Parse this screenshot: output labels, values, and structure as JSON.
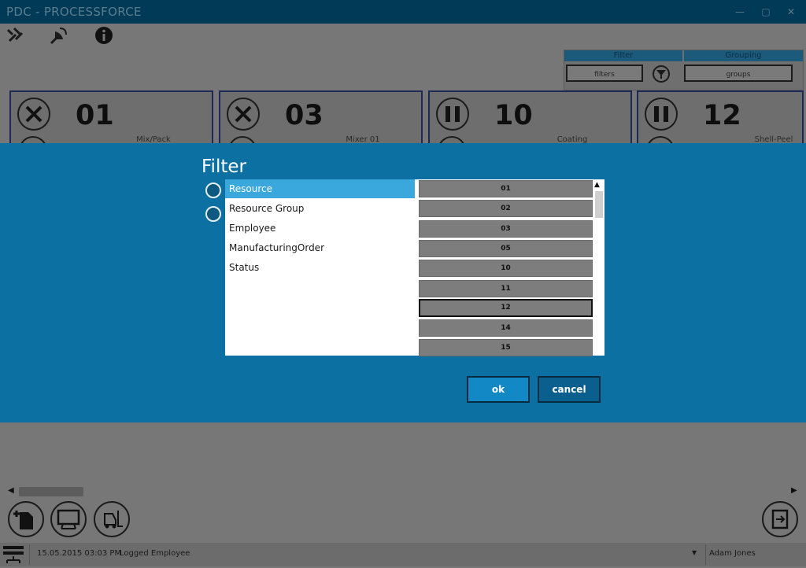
{
  "window": {
    "title": "PDC - PROCESSFORCE",
    "minimize": "—",
    "maximize": "▢",
    "close": "✕"
  },
  "toolbar": {
    "icons": [
      "tools-icon",
      "satellite-icon",
      "info-icon"
    ]
  },
  "filter_panel": {
    "filter_header": "Filter",
    "grouping_header": "Grouping",
    "filters_button": "filters",
    "groups_button": "groups"
  },
  "cards": [
    {
      "number": "01",
      "name": "Mix/Pack",
      "status_icon": "tools-icon"
    },
    {
      "number": "03",
      "name": "Mixer 01",
      "status_icon": "tools-icon"
    },
    {
      "number": "10",
      "name": "Coating",
      "status_icon": "pause-icon"
    },
    {
      "number": "12",
      "name": "Shell-Peel",
      "status_icon": "pause-icon"
    }
  ],
  "dialog": {
    "title": "Filter",
    "categories": [
      {
        "label": "Resource",
        "selected": true
      },
      {
        "label": "Resource Group",
        "selected": false
      },
      {
        "label": "Employee",
        "selected": false
      },
      {
        "label": "ManufacturingOrder",
        "selected": false
      },
      {
        "label": "Status",
        "selected": false
      }
    ],
    "values": [
      "01",
      "02",
      "03",
      "05",
      "10",
      "11",
      "12",
      "14",
      "15"
    ],
    "focused_value": "12",
    "ok_label": "ok",
    "cancel_label": "cancel"
  },
  "bottom_bar": {
    "buttons": [
      "add-document-icon",
      "monitor-icon",
      "forklift-icon"
    ],
    "logout_icon": "logout-icon"
  },
  "status": {
    "datetime": "15.05.2015 03:03 PM",
    "employee_label": "Logged Employee",
    "employee_name": "Adam Jones"
  },
  "colors": {
    "dialog_bg": "#0c70a3",
    "selected_item": "#3aa8dd",
    "title_bar": "#003a57"
  }
}
